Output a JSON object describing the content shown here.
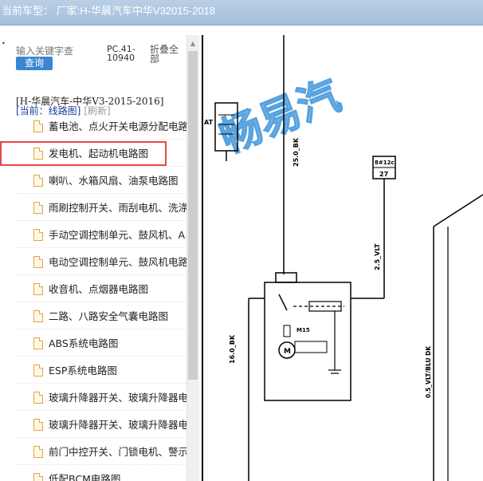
{
  "window": {
    "title": "当前车型：  厂家:H-华晨汽车中华V32015-2018"
  },
  "sidebar": {
    "search_placeholder": "输入关键字查",
    "search_button": "查询",
    "dot": "•",
    "pc_code": "PC.41-10940",
    "collapse_all": "折叠全部",
    "model_title": "[H-华晨汽车-中华V3-2015-2016]",
    "current_label": "[当前：线路图]",
    "refresh_label": "[刷新]",
    "items": [
      {
        "label": "蓄电池、点火开关电源分配电路"
      },
      {
        "label": "发电机、起动机电路图"
      },
      {
        "label": "喇叭、水箱风扇、油泵电路图"
      },
      {
        "label": "雨刷控制开关、雨刮电机、洗涤"
      },
      {
        "label": "手动空调控制单元、鼓风机、A"
      },
      {
        "label": "电动空调控制单元、鼓风机电路"
      },
      {
        "label": "收音机、点烟器电路图"
      },
      {
        "label": "二路、八路安全气囊电路图"
      },
      {
        "label": "ABS系统电路图"
      },
      {
        "label": "ESP系统电路图"
      },
      {
        "label": "玻璃升降器开关、玻璃升降器电"
      },
      {
        "label": "玻璃升降器开关、玻璃升降器电"
      },
      {
        "label": "前门中控开关、门锁电机、警示"
      },
      {
        "label": "低配BCM电路图"
      }
    ],
    "selected_index": 1
  },
  "diagram": {
    "watermark": "畅易汽",
    "labels": {
      "left_wire": "25.0_BK",
      "connector_top": "8#12c",
      "connector_num": "27",
      "mid_wire": "2.5_VLT",
      "lower_left_wire": "16.0_BK",
      "motor_label": "M15",
      "motor_symbol": "M",
      "right_wire": "0.5_VLT/BLU DK",
      "at_label": "AT"
    }
  },
  "colors": {
    "titlebar": "#a4bedb",
    "accent_blue": "#3b86d1",
    "highlight_red": "#e24a4a",
    "watermark": "#2e8bd8"
  }
}
